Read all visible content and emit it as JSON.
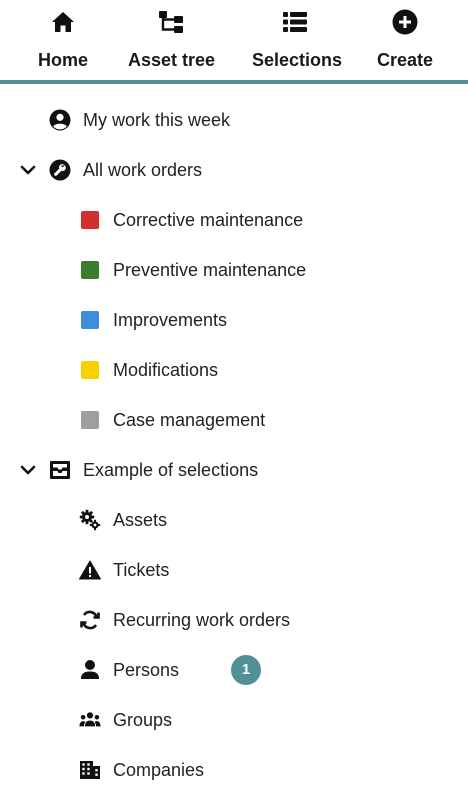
{
  "nav": {
    "items": [
      {
        "label": "Home",
        "icon": "home-icon"
      },
      {
        "label": "Asset tree",
        "icon": "asset-tree-icon"
      },
      {
        "label": "Selections",
        "icon": "list-icon"
      },
      {
        "label": "Create",
        "icon": "plus-circle-icon"
      }
    ],
    "accent": "#4f9194"
  },
  "menu": {
    "my_work": {
      "label": "My work this week",
      "icon": "user-circle-icon"
    },
    "all_work_orders": {
      "label": "All work orders",
      "icon": "wrench-icon",
      "expanded": true,
      "items": [
        {
          "label": "Corrective maintenance",
          "color": "#d32f2f"
        },
        {
          "label": "Preventive maintenance",
          "color": "#3a7d2c"
        },
        {
          "label": "Improvements",
          "color": "#3d8fd9"
        },
        {
          "label": "Modifications",
          "color": "#f7d000"
        },
        {
          "label": "Case management",
          "color": "#9e9e9e"
        }
      ]
    },
    "selections": {
      "label": "Example of selections",
      "icon": "inbox-icon",
      "expanded": true,
      "items": [
        {
          "label": "Assets",
          "icon": "gears-icon"
        },
        {
          "label": "Tickets",
          "icon": "warning-icon"
        },
        {
          "label": "Recurring work orders",
          "icon": "sync-icon"
        },
        {
          "label": "Persons",
          "icon": "person-icon",
          "badge": "1"
        },
        {
          "label": "Groups",
          "icon": "group-icon"
        },
        {
          "label": "Companies",
          "icon": "building-icon"
        }
      ]
    }
  }
}
